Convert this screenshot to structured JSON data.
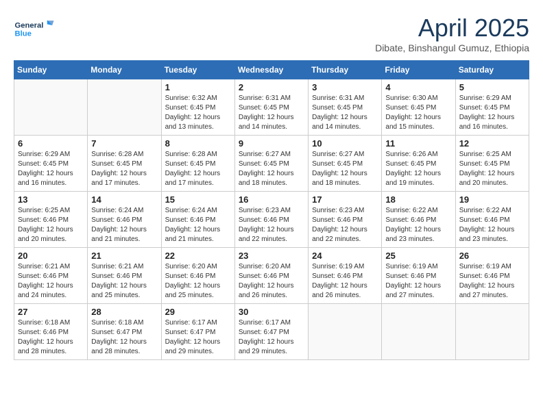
{
  "logo": {
    "line1": "General",
    "line2": "Blue"
  },
  "title": "April 2025",
  "subtitle": "Dibate, Binshangul Gumuz, Ethiopia",
  "weekdays": [
    "Sunday",
    "Monday",
    "Tuesday",
    "Wednesday",
    "Thursday",
    "Friday",
    "Saturday"
  ],
  "weeks": [
    [
      {
        "day": null,
        "info": null
      },
      {
        "day": null,
        "info": null
      },
      {
        "day": "1",
        "info": "Sunrise: 6:32 AM\nSunset: 6:45 PM\nDaylight: 12 hours and 13 minutes."
      },
      {
        "day": "2",
        "info": "Sunrise: 6:31 AM\nSunset: 6:45 PM\nDaylight: 12 hours and 14 minutes."
      },
      {
        "day": "3",
        "info": "Sunrise: 6:31 AM\nSunset: 6:45 PM\nDaylight: 12 hours and 14 minutes."
      },
      {
        "day": "4",
        "info": "Sunrise: 6:30 AM\nSunset: 6:45 PM\nDaylight: 12 hours and 15 minutes."
      },
      {
        "day": "5",
        "info": "Sunrise: 6:29 AM\nSunset: 6:45 PM\nDaylight: 12 hours and 16 minutes."
      }
    ],
    [
      {
        "day": "6",
        "info": "Sunrise: 6:29 AM\nSunset: 6:45 PM\nDaylight: 12 hours and 16 minutes."
      },
      {
        "day": "7",
        "info": "Sunrise: 6:28 AM\nSunset: 6:45 PM\nDaylight: 12 hours and 17 minutes."
      },
      {
        "day": "8",
        "info": "Sunrise: 6:28 AM\nSunset: 6:45 PM\nDaylight: 12 hours and 17 minutes."
      },
      {
        "day": "9",
        "info": "Sunrise: 6:27 AM\nSunset: 6:45 PM\nDaylight: 12 hours and 18 minutes."
      },
      {
        "day": "10",
        "info": "Sunrise: 6:27 AM\nSunset: 6:45 PM\nDaylight: 12 hours and 18 minutes."
      },
      {
        "day": "11",
        "info": "Sunrise: 6:26 AM\nSunset: 6:45 PM\nDaylight: 12 hours and 19 minutes."
      },
      {
        "day": "12",
        "info": "Sunrise: 6:25 AM\nSunset: 6:45 PM\nDaylight: 12 hours and 20 minutes."
      }
    ],
    [
      {
        "day": "13",
        "info": "Sunrise: 6:25 AM\nSunset: 6:46 PM\nDaylight: 12 hours and 20 minutes."
      },
      {
        "day": "14",
        "info": "Sunrise: 6:24 AM\nSunset: 6:46 PM\nDaylight: 12 hours and 21 minutes."
      },
      {
        "day": "15",
        "info": "Sunrise: 6:24 AM\nSunset: 6:46 PM\nDaylight: 12 hours and 21 minutes."
      },
      {
        "day": "16",
        "info": "Sunrise: 6:23 AM\nSunset: 6:46 PM\nDaylight: 12 hours and 22 minutes."
      },
      {
        "day": "17",
        "info": "Sunrise: 6:23 AM\nSunset: 6:46 PM\nDaylight: 12 hours and 22 minutes."
      },
      {
        "day": "18",
        "info": "Sunrise: 6:22 AM\nSunset: 6:46 PM\nDaylight: 12 hours and 23 minutes."
      },
      {
        "day": "19",
        "info": "Sunrise: 6:22 AM\nSunset: 6:46 PM\nDaylight: 12 hours and 23 minutes."
      }
    ],
    [
      {
        "day": "20",
        "info": "Sunrise: 6:21 AM\nSunset: 6:46 PM\nDaylight: 12 hours and 24 minutes."
      },
      {
        "day": "21",
        "info": "Sunrise: 6:21 AM\nSunset: 6:46 PM\nDaylight: 12 hours and 25 minutes."
      },
      {
        "day": "22",
        "info": "Sunrise: 6:20 AM\nSunset: 6:46 PM\nDaylight: 12 hours and 25 minutes."
      },
      {
        "day": "23",
        "info": "Sunrise: 6:20 AM\nSunset: 6:46 PM\nDaylight: 12 hours and 26 minutes."
      },
      {
        "day": "24",
        "info": "Sunrise: 6:19 AM\nSunset: 6:46 PM\nDaylight: 12 hours and 26 minutes."
      },
      {
        "day": "25",
        "info": "Sunrise: 6:19 AM\nSunset: 6:46 PM\nDaylight: 12 hours and 27 minutes."
      },
      {
        "day": "26",
        "info": "Sunrise: 6:19 AM\nSunset: 6:46 PM\nDaylight: 12 hours and 27 minutes."
      }
    ],
    [
      {
        "day": "27",
        "info": "Sunrise: 6:18 AM\nSunset: 6:46 PM\nDaylight: 12 hours and 28 minutes."
      },
      {
        "day": "28",
        "info": "Sunrise: 6:18 AM\nSunset: 6:47 PM\nDaylight: 12 hours and 28 minutes."
      },
      {
        "day": "29",
        "info": "Sunrise: 6:17 AM\nSunset: 6:47 PM\nDaylight: 12 hours and 29 minutes."
      },
      {
        "day": "30",
        "info": "Sunrise: 6:17 AM\nSunset: 6:47 PM\nDaylight: 12 hours and 29 minutes."
      },
      {
        "day": null,
        "info": null
      },
      {
        "day": null,
        "info": null
      },
      {
        "day": null,
        "info": null
      }
    ]
  ]
}
